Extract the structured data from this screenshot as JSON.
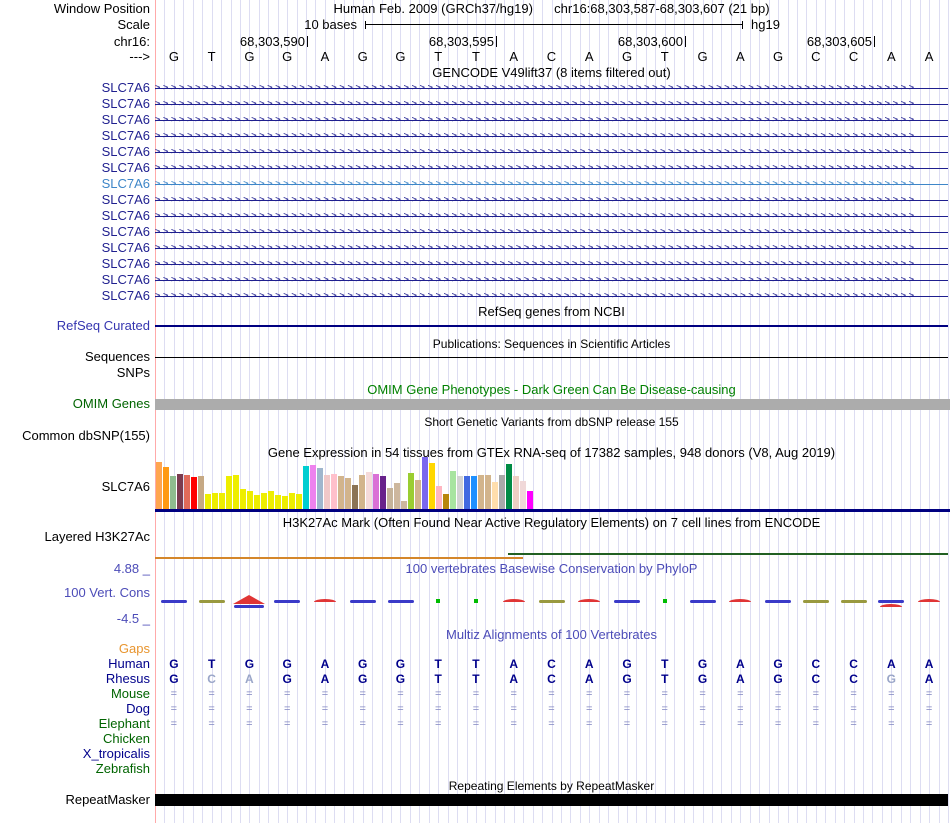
{
  "header": {
    "window_position_label": "Window Position",
    "assembly_title": "Human Feb. 2009 (GRCh37/hg19)",
    "position_title": "chr16:68,303,587-68,303,607 (21 bp)",
    "scale_label": "Scale",
    "scale_value": "10 bases",
    "assembly_short": "hg19",
    "chrom_label": "chr16:",
    "coords": [
      "68,303,590",
      "68,303,595",
      "68,303,600",
      "68,303,605"
    ],
    "strand_label": "--->"
  },
  "sequence": {
    "bases": [
      "G",
      "T",
      "G",
      "G",
      "A",
      "G",
      "G",
      "T",
      "T",
      "A",
      "C",
      "A",
      "G",
      "T",
      "G",
      "A",
      "G",
      "C",
      "C",
      "A",
      "A"
    ]
  },
  "colors": {
    "gene_normal": "#1F1F8F",
    "gene_highlight": "#3E86C8",
    "navy_line": "#000080",
    "grid": "#DDDDF2",
    "track_edge_pink": "#FFAAAA",
    "omim_bar_gray": "#ACACAC",
    "h3k_orange": "#D4862A",
    "h3k_green": "#226022",
    "cons_blue": "#3A3AC8",
    "cons_olive": "#99993F",
    "cons_red": "#E03535",
    "cons_green": "#00BB00",
    "blue_title": "#4C4CB8",
    "green_title": "#008000",
    "eq_color": "#8085C0",
    "rhesus_muted": "#9AA6C8"
  },
  "tracks": {
    "gencode": {
      "title": "GENCODE V49lift37 (8 items filtered out)",
      "genes": [
        {
          "label": "SLC7A6",
          "highlighted": false
        },
        {
          "label": "SLC7A6",
          "highlighted": false
        },
        {
          "label": "SLC7A6",
          "highlighted": false
        },
        {
          "label": "SLC7A6",
          "highlighted": false
        },
        {
          "label": "SLC7A6",
          "highlighted": false
        },
        {
          "label": "SLC7A6",
          "highlighted": false
        },
        {
          "label": "SLC7A6",
          "highlighted": true
        },
        {
          "label": "SLC7A6",
          "highlighted": false
        },
        {
          "label": "SLC7A6",
          "highlighted": false
        },
        {
          "label": "SLC7A6",
          "highlighted": false
        },
        {
          "label": "SLC7A6",
          "highlighted": false
        },
        {
          "label": "SLC7A6",
          "highlighted": false
        },
        {
          "label": "SLC7A6",
          "highlighted": false
        },
        {
          "label": "SLC7A6",
          "highlighted": false
        }
      ]
    },
    "refseq": {
      "title": "RefSeq genes from NCBI",
      "label": "RefSeq Curated"
    },
    "publications": {
      "title": "Publications: Sequences in Scientific Articles",
      "label": "Sequences"
    },
    "snps_label": "SNPs",
    "omim": {
      "title": "OMIM Gene Phenotypes - Dark Green Can Be Disease-causing",
      "label": "OMIM Genes"
    },
    "dbsnp": {
      "title": "Short Genetic Variants from dbSNP release 155",
      "label": "Common dbSNP(155)"
    },
    "gtex": {
      "title": "Gene Expression in 54 tissues from GTEx RNA-seq of 17382 samples, 948 donors (V8, Aug 2019)",
      "gene_label": "SLC7A6"
    },
    "h3k27ac": {
      "title": "H3K27Ac Mark (Often Found Near Active Regulatory Elements) on 7 cell lines from ENCODE",
      "label": "Layered H3K27Ac"
    },
    "conservation": {
      "title": "100 vertebrates Basewise Conservation by PhyloP",
      "label": "100 Vert. Cons",
      "max_label": "4.88 _",
      "min_label": "-4.5 _",
      "marks": [
        "blue",
        "olive",
        "redpeak",
        "blue",
        "red",
        "blue",
        "blue",
        "green",
        "green",
        "red",
        "olive",
        "red",
        "blue",
        "green",
        "blue",
        "red",
        "blue",
        "olive",
        "olive",
        "bluered",
        "red"
      ]
    },
    "multiz": {
      "title": "Multiz Alignments of 100 Vertebrates",
      "eq_glyph": "=",
      "species": [
        {
          "name": "Gaps",
          "label_color": "#E8952F",
          "cell_type": "none"
        },
        {
          "name": "Human",
          "label_color": "#00008B",
          "cell_type": "base",
          "cells": [
            "G",
            "T",
            "G",
            "G",
            "A",
            "G",
            "G",
            "T",
            "T",
            "A",
            "C",
            "A",
            "G",
            "T",
            "G",
            "A",
            "G",
            "C",
            "C",
            "A",
            "A"
          ],
          "muted_indices": []
        },
        {
          "name": "Rhesus",
          "label_color": "#00008B",
          "cell_type": "base",
          "cells": [
            "G",
            "C",
            "A",
            "G",
            "A",
            "G",
            "G",
            "T",
            "T",
            "A",
            "C",
            "A",
            "G",
            "T",
            "G",
            "A",
            "G",
            "C",
            "C",
            "G",
            "A"
          ],
          "muted_indices": [
            1,
            2,
            19
          ]
        },
        {
          "name": "Mouse",
          "label_color": "#006400",
          "cell_type": "eq"
        },
        {
          "name": "Dog",
          "label_color": "#00008B",
          "cell_type": "eq"
        },
        {
          "name": "Elephant",
          "label_color": "#006400",
          "cell_type": "eq"
        },
        {
          "name": "Chicken",
          "label_color": "#006400",
          "cell_type": "none"
        },
        {
          "name": "X_tropicalis",
          "label_color": "#00008B",
          "cell_type": "none"
        },
        {
          "name": "Zebrafish",
          "label_color": "#006400",
          "cell_type": "none"
        }
      ]
    },
    "repeatmasker": {
      "title": "Repeating Elements by RepeatMasker",
      "label": "RepeatMasker"
    }
  },
  "chart_data": {
    "type": "bar",
    "title": "Gene Expression in 54 tissues from GTEx RNA-seq of 17382 samples, 948 donors (V8, Aug 2019)",
    "gene": "SLC7A6",
    "ylabel": "expression (relative bar height, px, no axis shown)",
    "bars": [
      {
        "color": "#FFA54F",
        "value": 47
      },
      {
        "color": "#FF9912",
        "value": 42
      },
      {
        "color": "#8FBC8F",
        "value": 33
      },
      {
        "color": "#7A3B4F",
        "value": 35
      },
      {
        "color": "#E06A5A",
        "value": 34
      },
      {
        "color": "#FF0000",
        "value": 32
      },
      {
        "color": "#C6A984",
        "value": 33
      },
      {
        "color": "#EEEE00",
        "value": 15
      },
      {
        "color": "#EEEE00",
        "value": 16
      },
      {
        "color": "#EEEE00",
        "value": 16
      },
      {
        "color": "#EEEE00",
        "value": 33
      },
      {
        "color": "#EEEE00",
        "value": 34
      },
      {
        "color": "#EEEE00",
        "value": 20
      },
      {
        "color": "#EEEE00",
        "value": 18
      },
      {
        "color": "#EEEE00",
        "value": 14
      },
      {
        "color": "#EEEE00",
        "value": 16
      },
      {
        "color": "#EEEE00",
        "value": 18
      },
      {
        "color": "#EEEE00",
        "value": 14
      },
      {
        "color": "#EEEE00",
        "value": 13
      },
      {
        "color": "#EEEE00",
        "value": 16
      },
      {
        "color": "#EEEE00",
        "value": 15
      },
      {
        "color": "#00CED1",
        "value": 43
      },
      {
        "color": "#EE82EE",
        "value": 44
      },
      {
        "color": "#9FB6CD",
        "value": 41
      },
      {
        "color": "#F0C8C8",
        "value": 34
      },
      {
        "color": "#FFC0CB",
        "value": 35
      },
      {
        "color": "#D2B48C",
        "value": 33
      },
      {
        "color": "#D2B48C",
        "value": 31
      },
      {
        "color": "#8B7355",
        "value": 24
      },
      {
        "color": "#D2B48C",
        "value": 34
      },
      {
        "color": "#F5DADA",
        "value": 37
      },
      {
        "color": "#DA70D6",
        "value": 35
      },
      {
        "color": "#68228B",
        "value": 33
      },
      {
        "color": "#C5B39A",
        "value": 21
      },
      {
        "color": "#CDB79E",
        "value": 26
      },
      {
        "color": "#CDB79E",
        "value": 8
      },
      {
        "color": "#9ACD32",
        "value": 36
      },
      {
        "color": "#D2B48C",
        "value": 29
      },
      {
        "color": "#7A67EE",
        "value": 52
      },
      {
        "color": "#FFD700",
        "value": 46
      },
      {
        "color": "#FFB6C1",
        "value": 23
      },
      {
        "color": "#B8860B",
        "value": 15
      },
      {
        "color": "#A8E4A0",
        "value": 38
      },
      {
        "color": "#D3D3D3",
        "value": 33
      },
      {
        "color": "#4169E1",
        "value": 33
      },
      {
        "color": "#1E90FF",
        "value": 33
      },
      {
        "color": "#D2B48C",
        "value": 34
      },
      {
        "color": "#D2B48C",
        "value": 34
      },
      {
        "color": "#FFDEAD",
        "value": 27
      },
      {
        "color": "#A9A9A9",
        "value": 34
      },
      {
        "color": "#008B45",
        "value": 45
      },
      {
        "color": "#EECFC4",
        "value": 33
      },
      {
        "color": "#F0D8D8",
        "value": 28
      },
      {
        "color": "#FF00FF",
        "value": 18
      }
    ]
  }
}
